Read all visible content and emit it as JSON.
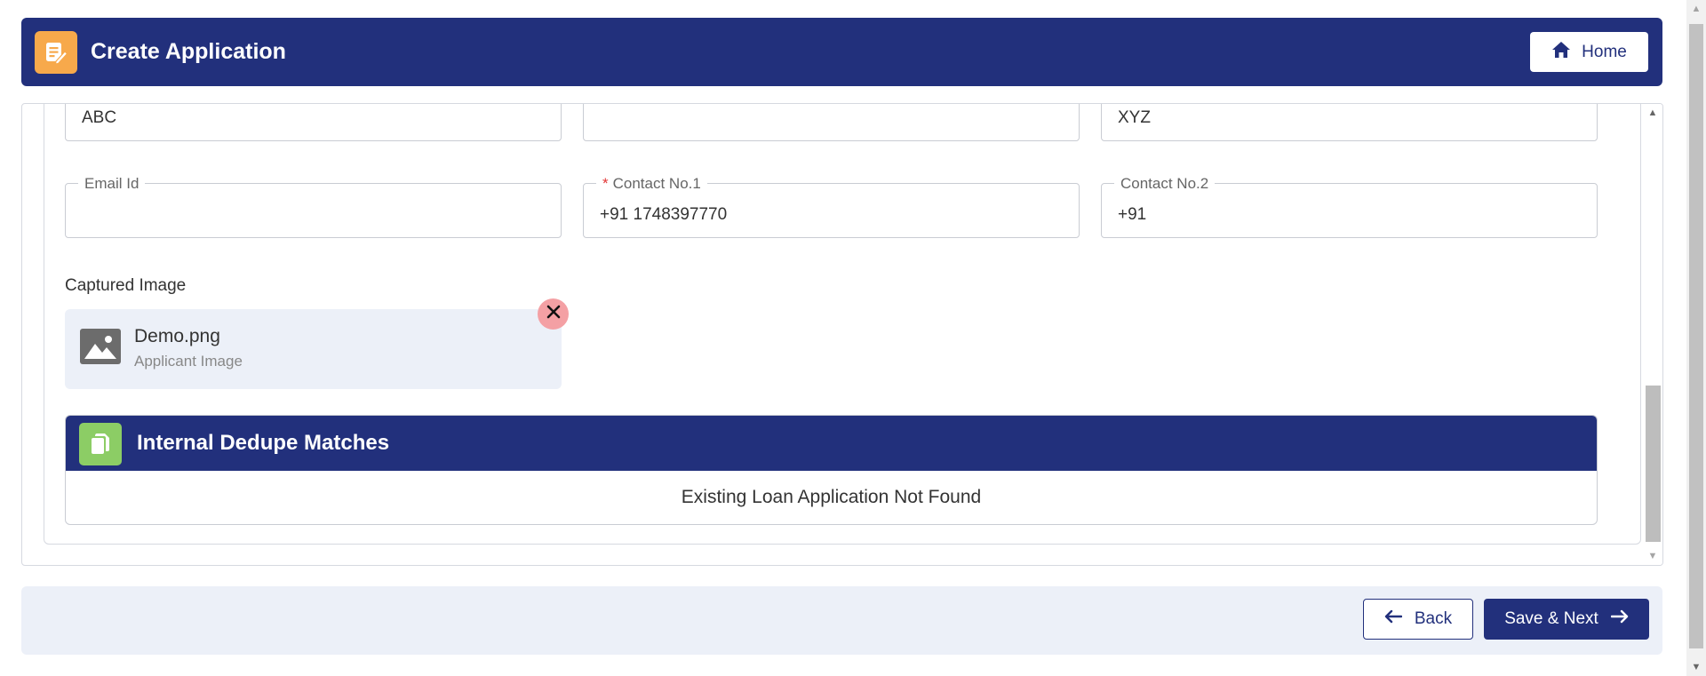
{
  "header": {
    "title": "Create Application",
    "home_label": "Home",
    "icon": "edit-document-icon",
    "bg_color": "#22307c",
    "icon_bg": "#f7a94b"
  },
  "form": {
    "row1": [
      {
        "value": "ABC"
      },
      {
        "value": ""
      },
      {
        "value": "XYZ"
      }
    ],
    "email": {
      "label": "Email Id",
      "value": ""
    },
    "contact1": {
      "label": "Contact No.1",
      "required_mark": "*",
      "value": "+91 1748397770"
    },
    "contact2": {
      "label": "Contact No.2",
      "value": "+91"
    }
  },
  "captured_image": {
    "section_label": "Captured Image",
    "file_name": "Demo.png",
    "caption": "Applicant Image",
    "icon": "image-icon",
    "remove_icon": "close-icon"
  },
  "dedupe": {
    "title": "Internal Dedupe Matches",
    "message": "Existing Loan Application Not Found",
    "icon": "copy-document-icon",
    "icon_bg": "#8ccd65"
  },
  "footer": {
    "back_label": "Back",
    "next_label": "Save & Next"
  }
}
